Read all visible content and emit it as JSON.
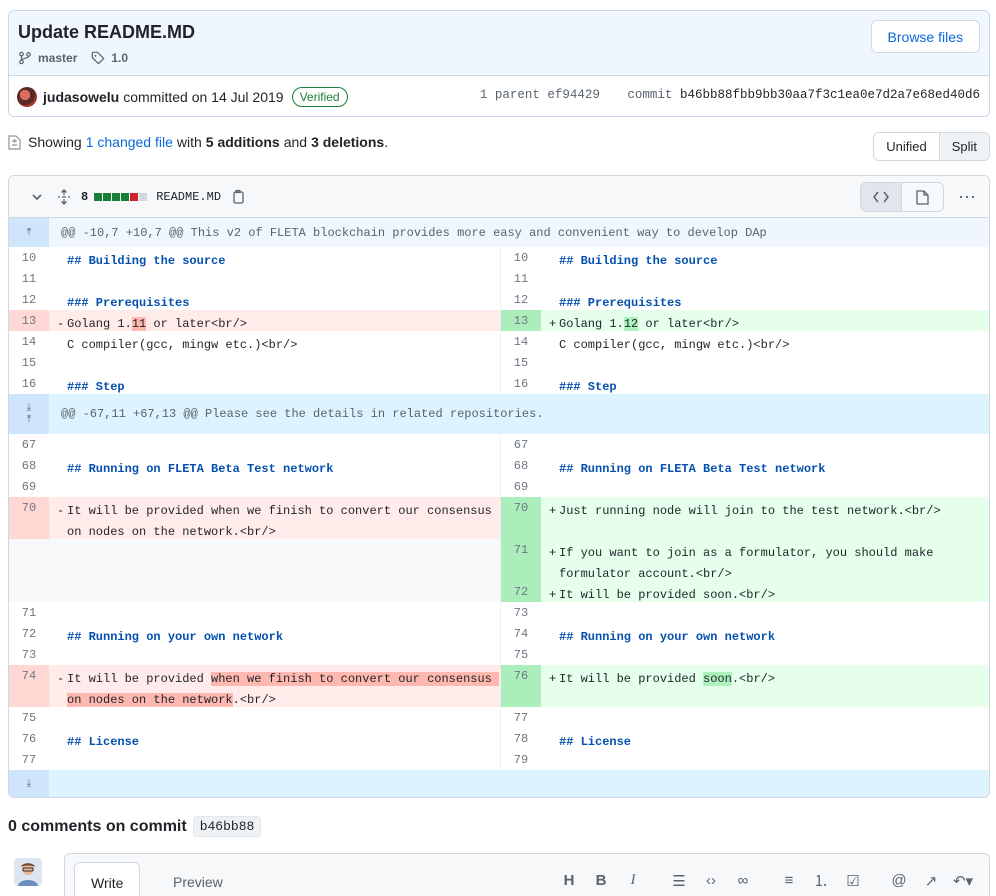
{
  "commit": {
    "title": "Update README.MD",
    "branch": "master",
    "tag": "1.0",
    "browse_label": "Browse files",
    "author": "judasowelu",
    "committed_text": "committed on 14 Jul 2019",
    "verified": "Verified",
    "parent_label": "1 parent",
    "parent_sha": "ef94429",
    "commit_label": "commit",
    "commit_sha": "b46bb88fbb9bb30aa7f3c1ea0e7d2a7e68ed40d6"
  },
  "summary": {
    "showing": "Showing",
    "changed": "1 changed file",
    "with": "with",
    "additions": "5 additions",
    "and": "and",
    "deletions": "3 deletions",
    "period": "."
  },
  "view_toggle": {
    "unified": "Unified",
    "split": "Split"
  },
  "file": {
    "change_count": "8",
    "name": "README.MD",
    "diffstat_colors": [
      "#1a7f37",
      "#1a7f37",
      "#1a7f37",
      "#1a7f37",
      "#cf222e",
      "#d1d9e0"
    ]
  },
  "hunks": {
    "h1": "@@ -10,7 +10,7 @@ This v2 of FLETA blockchain provides more easy and convenient way to develop DAp",
    "h2": "@@ -67,11 +67,13 @@ Please see the details in related repositories."
  },
  "lines": {
    "l10": "10",
    "l11": "11",
    "l12": "12",
    "l13": "13",
    "l14": "14",
    "l15": "15",
    "l16": "16",
    "l67": "67",
    "l68": "68",
    "l69": "69",
    "l70": "70",
    "l71": "71",
    "l72": "72",
    "l73": "73",
    "l74": "74",
    "l75": "75",
    "l76": "76",
    "l77": "77",
    "l78": "78",
    "l79": "79"
  },
  "code": {
    "building": "## Building the source",
    "prereq": "### Prerequisites",
    "golang_a": "Golang 1.",
    "golang_old_v": "11",
    "golang_new_v": "12",
    "golang_b": " or later<br/>",
    "ccompiler": "C compiler(gcc, mingw etc.)<br/>",
    "step": "### Step",
    "running_fleta": "## Running on FLETA Beta Test network",
    "provided_finish": "It will be provided when we finish to convert our consensus on nodes on the network.<br/>",
    "just_running": "Just running node will join to the test network.<br/>",
    "formulator": "If you want to join as a formulator, you should make formulator account.<br/>",
    "provided_soon": "It will be provided soon.<br/>",
    "running_own": "## Running on your own network",
    "provided_prefix": "It will be provided ",
    "provided_old_mark": "when we finish to convert our consensus on nodes on the network",
    "provided_new_mark": "soon",
    "provided_suffix": ".<br/>",
    "license": "## License",
    "minus": "-",
    "plus": "+"
  },
  "comments": {
    "title": "0 comments on commit",
    "sha": "b46bb88",
    "write": "Write",
    "preview": "Preview"
  },
  "toolbar_icons": [
    "heading-icon",
    "bold-icon",
    "italic-icon",
    "quote-icon",
    "code-icon",
    "link-icon",
    "unordered-list-icon",
    "ordered-list-icon",
    "task-list-icon",
    "mention-icon",
    "reference-icon",
    "reply-icon"
  ]
}
